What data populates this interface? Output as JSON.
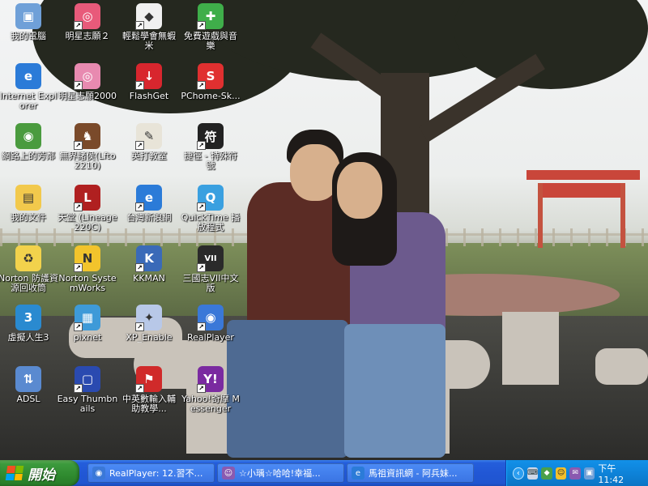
{
  "desktop": {
    "icons": [
      {
        "label": "我的電腦",
        "glyph": "computer-icon",
        "color": "#6fa0d8",
        "shortcut": false
      },
      {
        "label": "明星志願２",
        "glyph": "disc-icon",
        "color": "#e85a7a",
        "shortcut": true
      },
      {
        "label": "輕鬆學會無蝦米",
        "glyph": "cube-icon",
        "color": "#f0f0f0",
        "shortcut": true
      },
      {
        "label": "免費遊戲與音樂",
        "glyph": "gift-icon",
        "color": "#3fae4a",
        "shortcut": true
      },
      {
        "label": "Internet Explorer",
        "glyph": "ie-icon",
        "color": "#2b7bd8",
        "shortcut": false
      },
      {
        "label": "明星志願2000",
        "glyph": "disc-icon",
        "color": "#e88ab0",
        "shortcut": true
      },
      {
        "label": "FlashGet",
        "glyph": "flashget-icon",
        "color": "#d8262e",
        "shortcut": true
      },
      {
        "label": "PChome-Sk...",
        "glyph": "s-logo-icon",
        "color": "#e03030",
        "shortcut": true
      },
      {
        "label": "網路上的芳鄰",
        "glyph": "network-icon",
        "color": "#4a9b3e",
        "shortcut": false
      },
      {
        "label": "無界諸侯(Lfto2210)",
        "glyph": "dragon-icon",
        "color": "#7a4a2a",
        "shortcut": true
      },
      {
        "label": "英打教室",
        "glyph": "chicken-icon",
        "color": "#e8e4d8",
        "shortcut": true
      },
      {
        "label": "捷徑 - 特殊符號",
        "glyph": "symbol-icon",
        "color": "#222222",
        "shortcut": true
      },
      {
        "label": "我的文件",
        "glyph": "folder-icon",
        "color": "#f2c94c",
        "shortcut": false
      },
      {
        "label": "天堂 (Lineage 220C)",
        "glyph": "lineage-icon",
        "color": "#b02020",
        "shortcut": true
      },
      {
        "label": "台灣新浪網",
        "glyph": "ie-icon",
        "color": "#2b7bd8",
        "shortcut": true
      },
      {
        "label": "QuickTime 播放程式",
        "glyph": "quicktime-icon",
        "color": "#3aa0e0",
        "shortcut": true
      },
      {
        "label": "Norton 防護資源回收筒",
        "glyph": "recycle-icon",
        "color": "#f2d24c",
        "shortcut": false
      },
      {
        "label": "Norton SystemWorks",
        "glyph": "norton-icon",
        "color": "#f2c42c",
        "shortcut": true
      },
      {
        "label": "KKMAN",
        "glyph": "kkman-icon",
        "color": "#3a6ab8",
        "shortcut": true
      },
      {
        "label": "三國志VII中文版",
        "glyph": "sangokushi-icon",
        "color": "#2a2a2a",
        "shortcut": true
      },
      {
        "label": "虛擬人生3",
        "glyph": "sims-icon",
        "color": "#2a8ad0",
        "shortcut": false
      },
      {
        "label": "pixnet",
        "glyph": "pixnet-icon",
        "color": "#3e9ad8",
        "shortcut": true
      },
      {
        "label": "XP_Enable",
        "glyph": "sparkle-icon",
        "color": "#b8c8e8",
        "shortcut": true
      },
      {
        "label": "RealPlayer",
        "glyph": "realplayer-icon",
        "color": "#3a78d8",
        "shortcut": true
      },
      {
        "label": "ADSL",
        "glyph": "adsl-icon",
        "color": "#5a8ad0",
        "shortcut": false
      },
      {
        "label": "Easy Thumbnails",
        "glyph": "thumbnails-icon",
        "color": "#2a4ab0",
        "shortcut": true
      },
      {
        "label": "中英數輸入輔助教學...",
        "glyph": "flag-icon",
        "color": "#d02a2a",
        "shortcut": true
      },
      {
        "label": "Yahoo!奇摩 Messenger",
        "glyph": "yahoo-icon",
        "color": "#7a2aa0",
        "shortcut": true
      }
    ]
  },
  "taskbar": {
    "start_label": "開始",
    "tasks": [
      {
        "label": "RealPlayer: 12.習不習...",
        "icon": "realplayer-icon",
        "color": "#3a78d8"
      },
      {
        "label": "☆小瑀☆哈哈!幸福...",
        "icon": "messenger-icon",
        "color": "#8a5ab0"
      },
      {
        "label": "馬祖資訊網 - 阿兵妹...",
        "icon": "ie-icon",
        "color": "#2b7bd8"
      }
    ],
    "tray": {
      "icons": [
        {
          "name": "keyboard-icon",
          "color": "#cfd8e8"
        },
        {
          "name": "network-people-icon",
          "color": "#4aa04a"
        },
        {
          "name": "smiley-icon",
          "color": "#f2c02c"
        },
        {
          "name": "messenger-icon",
          "color": "#8a5ab0"
        },
        {
          "name": "computer-icon",
          "color": "#6fa0d8"
        }
      ],
      "clock": "下午 11:42"
    }
  }
}
